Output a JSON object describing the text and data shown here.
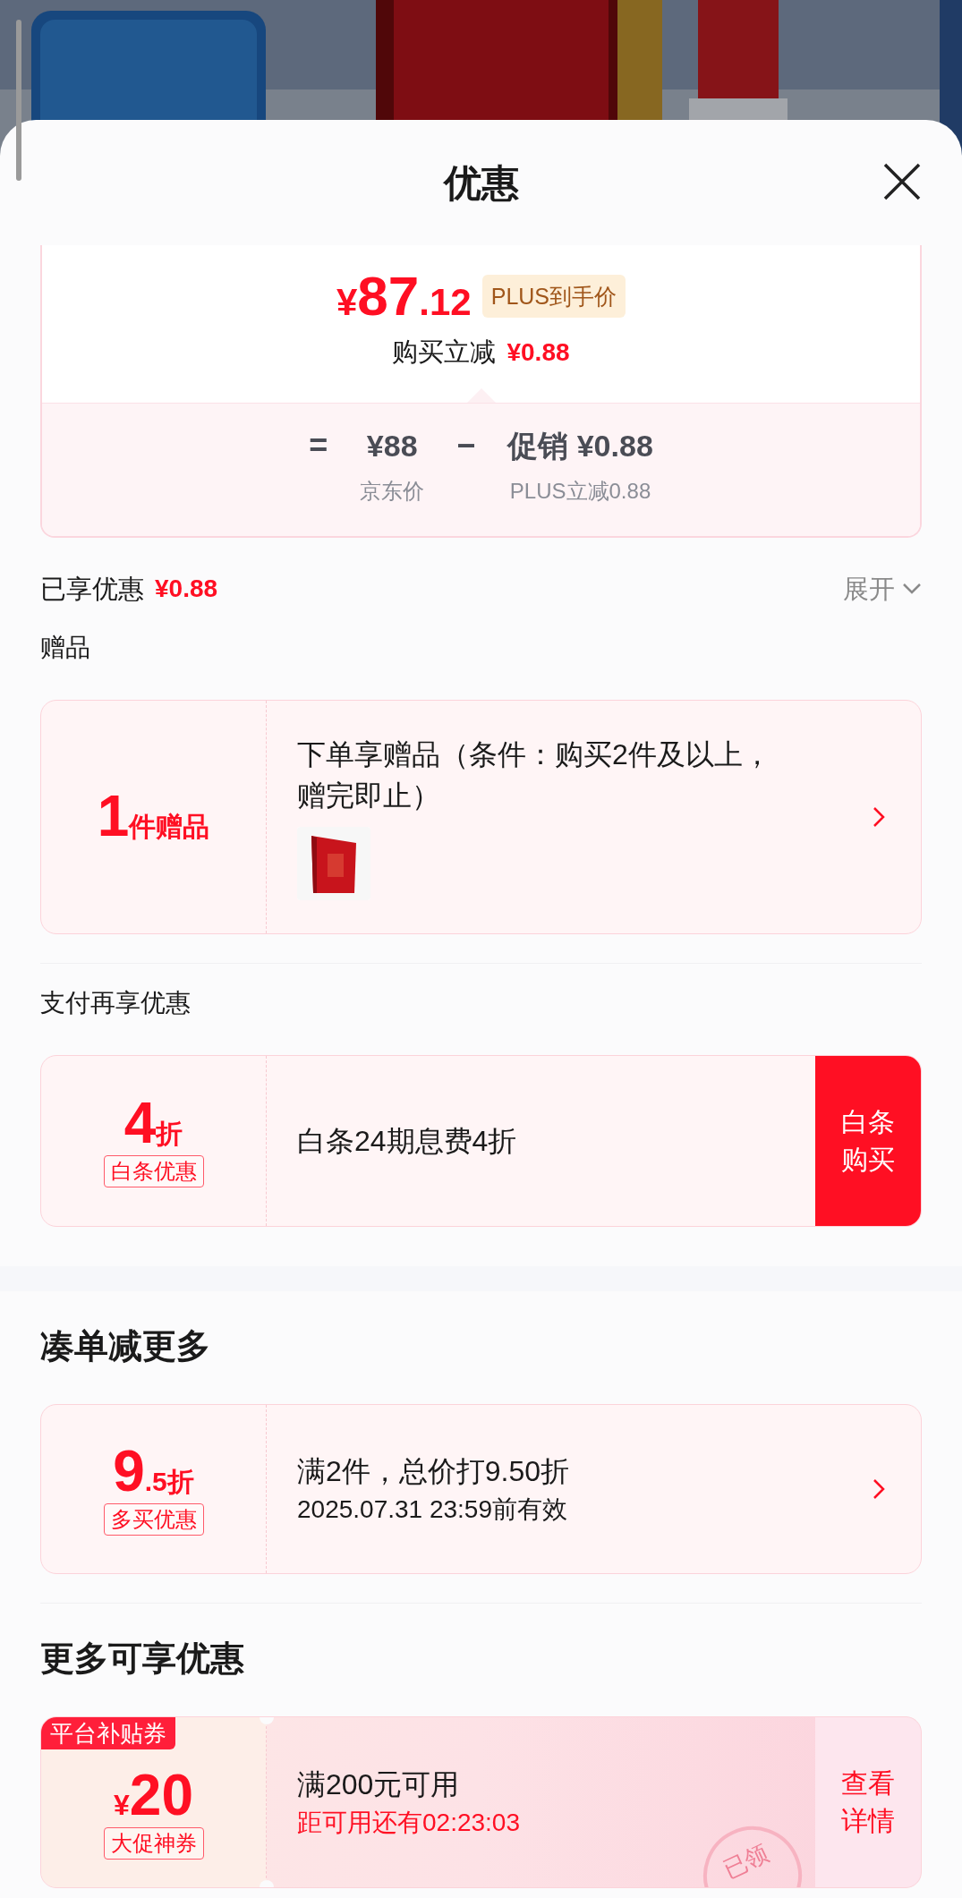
{
  "title": "优惠",
  "price_summary": {
    "currency": "¥",
    "integer": "87",
    "decimal": ".12",
    "badge": "PLUS到手价",
    "reduction_label": "购买立减",
    "reduction_value": "¥0.88",
    "breakdown": [
      {
        "symbol": "=",
        "amount": "¥88",
        "label": "京东价"
      },
      {
        "symbol": "−",
        "amount": "促销 ¥0.88",
        "label": "PLUS立减0.88"
      }
    ]
  },
  "enjoyed": {
    "label": "已享优惠",
    "value": "¥0.88",
    "toggle": "展开"
  },
  "groups": [
    {
      "sections": [
        {
          "heading": "赠品",
          "kind": "minor",
          "cards": [
            {
              "kind": "gift",
              "value": "1",
              "unit": "件赠品",
              "text": "下单享赠品（条件：购买2件及以上，赠完即止）"
            }
          ]
        },
        {
          "heading": "支付再享优惠",
          "kind": "minor",
          "cards": [
            {
              "kind": "payment",
              "value": "4",
              "unit": "折",
              "tag": "白条优惠",
              "text": "白条24期息费4折",
              "action": "白条购买"
            }
          ]
        }
      ]
    },
    {
      "sections": [
        {
          "heading": "凑单减更多",
          "kind": "major",
          "cards": [
            {
              "kind": "bundle",
              "value": "9",
              "decimal": ".5",
              "unit": "折",
              "tag": "多买优惠",
              "text": "满2件，总价打9.50折",
              "subtext": "2025.07.31 23:59前有效"
            }
          ]
        },
        {
          "heading": "更多可享优惠",
          "kind": "major",
          "cards": [
            {
              "kind": "coupon",
              "ribbon": "平台补贴券",
              "currency": "¥",
              "value": "20",
              "tag": "大促神券",
              "text": "满200元可用",
              "subtext": "距可用还有02:23:03",
              "action": "查看详情",
              "stamp": "已领"
            }
          ]
        }
      ]
    }
  ]
}
